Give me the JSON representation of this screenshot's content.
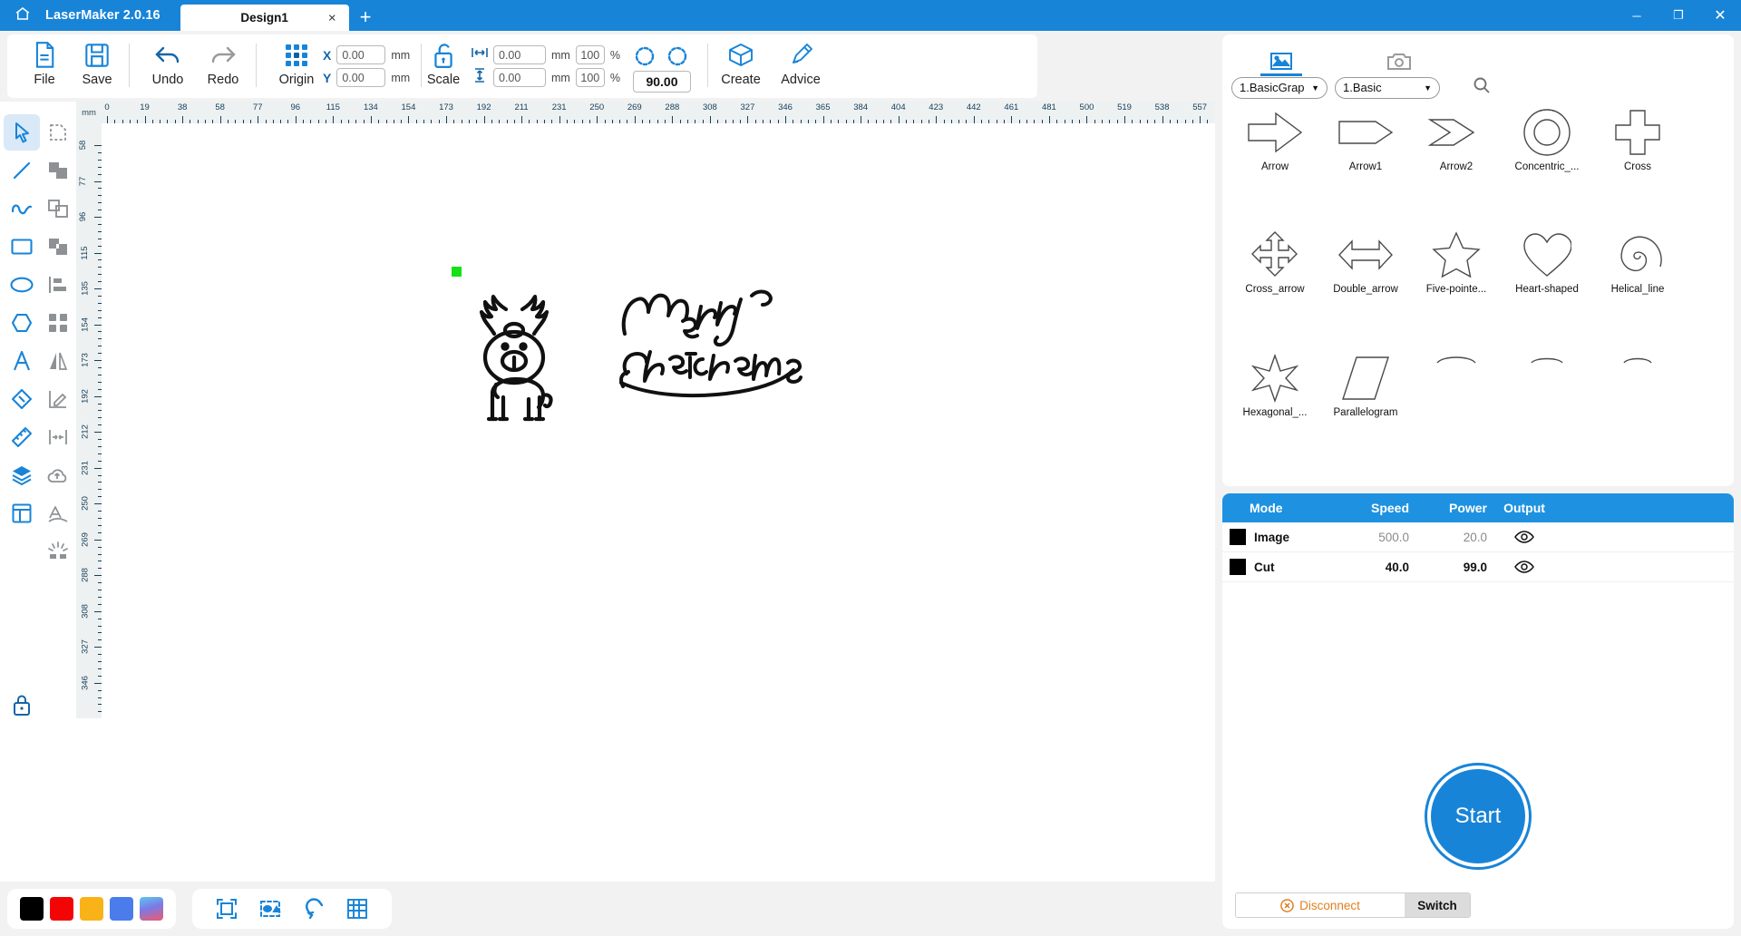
{
  "titlebar": {
    "home_icon": "home-icon",
    "app_name": "LaserMaker 2.0.16",
    "tabs": [
      {
        "label": "Design1",
        "close": "×"
      }
    ],
    "new_tab": "+",
    "window_buttons": {
      "minimize": "─",
      "maximize": "❐",
      "close": "✕"
    }
  },
  "toolbar": {
    "file_label": "File",
    "save_label": "Save",
    "undo_label": "Undo",
    "redo_label": "Redo",
    "origin_label": "Origin",
    "scale_label": "Scale",
    "create_label": "Create",
    "advice_label": "Advice",
    "x_label": "X",
    "y_label": "Y",
    "x_value": "0.00",
    "y_value": "0.00",
    "unit_mm": "mm",
    "width_value": "0.00",
    "height_value": "0.00",
    "width_pct": "100",
    "height_pct": "100",
    "percent": "%",
    "rotation_value": "90.00"
  },
  "left_tools": [
    {
      "name": "select-tool",
      "icon": "cursor-arrow-icon",
      "active": true
    },
    {
      "name": "node-edit-tool",
      "icon": "node-edit-icon",
      "active": false
    },
    {
      "name": "line-tool",
      "icon": "line-icon",
      "active": false
    },
    {
      "name": "union-tool",
      "icon": "union-shapes-icon",
      "active": false
    },
    {
      "name": "curve-tool",
      "icon": "curve-wave-icon",
      "active": false
    },
    {
      "name": "intersect-tool",
      "icon": "intersect-shapes-icon",
      "active": false
    },
    {
      "name": "rectangle-tool",
      "icon": "rectangle-icon",
      "active": false
    },
    {
      "name": "subtract-tool",
      "icon": "subtract-shapes-icon",
      "active": false
    },
    {
      "name": "ellipse-tool",
      "icon": "ellipse-icon",
      "active": false
    },
    {
      "name": "align-tool",
      "icon": "align-left-icon",
      "active": false
    },
    {
      "name": "polygon-tool",
      "icon": "hexagon-icon",
      "active": false
    },
    {
      "name": "distribute-tool",
      "icon": "grid-blocks-icon",
      "active": false
    },
    {
      "name": "text-tool",
      "icon": "text-a-icon",
      "active": false
    },
    {
      "name": "mirror-tool",
      "icon": "mirror-icon",
      "active": false
    },
    {
      "name": "eraser-tool",
      "icon": "eraser-icon",
      "active": false
    },
    {
      "name": "draw-measure-tool",
      "icon": "angle-pencil-icon",
      "active": false
    },
    {
      "name": "measure-tool",
      "icon": "ruler-icon",
      "active": false
    },
    {
      "name": "offset-tool",
      "icon": "offset-arrows-icon",
      "active": false
    },
    {
      "name": "layers-tool",
      "icon": "layers-stack-icon",
      "active": false
    },
    {
      "name": "cloud-tool",
      "icon": "cloud-shape-icon",
      "active": false
    },
    {
      "name": "layout-tool",
      "icon": "layout-panel-icon",
      "active": false
    },
    {
      "name": "text-path-tool",
      "icon": "text-on-path-icon",
      "active": false
    },
    {
      "name": "engrave-tool",
      "icon": "laser-burst-icon",
      "active": false
    }
  ],
  "lock_tool": {
    "name": "lock-canvas-button",
    "icon": "lock-icon"
  },
  "rulers": {
    "unit_label": "mm",
    "horizontal_ticks": [
      "0",
      "19",
      "38",
      "58",
      "77",
      "96",
      "115",
      "134",
      "154",
      "173",
      "192",
      "211",
      "231",
      "250",
      "269",
      "288",
      "308",
      "327",
      "346",
      "365",
      "384",
      "404",
      "423",
      "442",
      "461",
      "481",
      "500",
      "519",
      "538",
      "557"
    ],
    "vertical_ticks": [
      "58",
      "77",
      "96",
      "115",
      "135",
      "154",
      "173",
      "192",
      "212",
      "231",
      "250",
      "269",
      "288",
      "308",
      "327",
      "346"
    ]
  },
  "canvas": {
    "origin_marker": "green-origin-marker",
    "artwork": [
      {
        "name": "reindeer-artwork",
        "alt": "Reindeer line drawing"
      },
      {
        "name": "merry-christmas-artwork",
        "alt": "Merry Christmas lettering"
      }
    ]
  },
  "bottom_bar": {
    "swatches": [
      {
        "name": "color-swatch-black",
        "color": "#000000"
      },
      {
        "name": "color-swatch-red",
        "color": "#f40505"
      },
      {
        "name": "color-swatch-orange",
        "color": "#f9b218"
      },
      {
        "name": "color-swatch-blue",
        "color": "#4a7ceb"
      },
      {
        "name": "color-swatch-gradient",
        "color": "#5ec7ec"
      }
    ],
    "icons": [
      {
        "name": "fit-frame-icon"
      },
      {
        "name": "select-objects-icon"
      },
      {
        "name": "magnet-snap-icon"
      },
      {
        "name": "grid-icon"
      }
    ]
  },
  "right_panel": {
    "tabs": [
      {
        "name": "gallery-tab",
        "icon": "image-gallery-icon",
        "active": true
      },
      {
        "name": "camera-tab",
        "icon": "camera-icon",
        "active": false
      }
    ],
    "category_select": "1.BasicGrap",
    "subcategory_select": "1.Basic",
    "search_icon": "search-icon",
    "shapes": [
      {
        "name": "Arrow",
        "icon": "arrow-shape"
      },
      {
        "name": "Arrow1",
        "icon": "arrow1-shape"
      },
      {
        "name": "Arrow2",
        "icon": "arrow2-shape"
      },
      {
        "name": "Concentric_...",
        "icon": "concentric-circles-shape"
      },
      {
        "name": "Cross",
        "icon": "cross-shape"
      },
      {
        "name": "Cross_arrow",
        "icon": "cross-arrow-shape"
      },
      {
        "name": "Double_arrow",
        "icon": "double-arrow-shape"
      },
      {
        "name": "Five-pointe...",
        "icon": "five-pointed-star-shape"
      },
      {
        "name": "Heart-shaped",
        "icon": "heart-shape"
      },
      {
        "name": "Helical_line",
        "icon": "helical-line-shape"
      },
      {
        "name": "Hexagonal_...",
        "icon": "hexagonal-star-shape"
      },
      {
        "name": "Parallelogram",
        "icon": "parallelogram-shape"
      }
    ],
    "layer_table": {
      "columns": [
        "Mode",
        "Speed",
        "Power",
        "Output"
      ],
      "rows": [
        {
          "color": "#000000",
          "mode": "Image",
          "speed": "500.0",
          "power": "20.0",
          "output_icon": "eye-icon"
        },
        {
          "color": "#000000",
          "mode": "Cut",
          "speed": "40.0",
          "power": "99.0",
          "output_icon": "eye-icon"
        }
      ]
    },
    "start_button": "Start",
    "connection": {
      "status": "Disconnect",
      "status_icon": "disconnect-icon",
      "switch_label": "Switch"
    }
  }
}
